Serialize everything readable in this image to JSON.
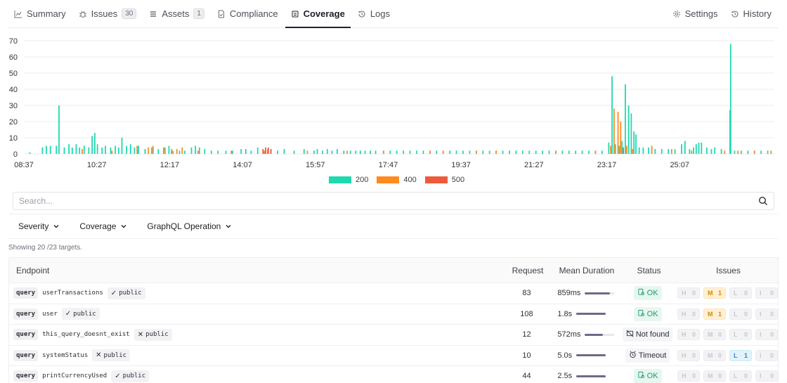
{
  "tabs": [
    {
      "label": "Summary",
      "icon": "chart-line-icon",
      "active": false
    },
    {
      "label": "Issues",
      "icon": "bug-icon",
      "count": "30",
      "active": false
    },
    {
      "label": "Assets",
      "icon": "list-icon",
      "count": "1",
      "active": false
    },
    {
      "label": "Compliance",
      "icon": "document-check-icon",
      "active": false
    },
    {
      "label": "Coverage",
      "icon": "coverage-icon",
      "active": true
    },
    {
      "label": "Logs",
      "icon": "history-icon",
      "active": false
    }
  ],
  "tabs_right": [
    {
      "label": "Settings",
      "icon": "gear-icon"
    },
    {
      "label": "History",
      "icon": "history-icon"
    }
  ],
  "colors": {
    "c200": "#1fd8b0",
    "c400": "#ff8a1f",
    "c500": "#ee5a3c",
    "accent": "#1b1f3b"
  },
  "chart_data": {
    "type": "bar",
    "y_ticks": [
      "0",
      "10",
      "20",
      "30",
      "40",
      "50",
      "60",
      "70"
    ],
    "ylim": [
      0,
      70
    ],
    "x_ticks": [
      "08:37",
      "10:27",
      "12:17",
      "14:07",
      "15:57",
      "17:47",
      "19:37",
      "21:27",
      "23:17",
      "25:07"
    ],
    "x_range_minutes": [
      517,
      1650
    ],
    "grid": true,
    "legend_position": "bottom-center",
    "series": [
      {
        "name": "200",
        "color": "#1fd8b0",
        "points": [
          [
            526,
            1
          ],
          [
            545,
            4
          ],
          [
            551,
            5
          ],
          [
            557,
            5
          ],
          [
            566,
            5
          ],
          [
            570,
            30
          ],
          [
            578,
            4
          ],
          [
            585,
            6
          ],
          [
            590,
            4
          ],
          [
            596,
            6
          ],
          [
            601,
            4
          ],
          [
            608,
            5
          ],
          [
            615,
            4
          ],
          [
            620,
            11
          ],
          [
            624,
            13
          ],
          [
            628,
            6
          ],
          [
            635,
            4
          ],
          [
            640,
            5
          ],
          [
            648,
            4
          ],
          [
            655,
            5
          ],
          [
            660,
            4
          ],
          [
            665,
            10
          ],
          [
            672,
            5
          ],
          [
            678,
            6
          ],
          [
            684,
            4
          ],
          [
            690,
            5
          ],
          [
            700,
            3
          ],
          [
            710,
            4
          ],
          [
            720,
            3
          ],
          [
            728,
            4
          ],
          [
            736,
            5
          ],
          [
            740,
            3
          ],
          [
            752,
            2
          ],
          [
            760,
            2
          ],
          [
            770,
            4
          ],
          [
            776,
            5
          ],
          [
            782,
            4
          ],
          [
            790,
            3
          ],
          [
            800,
            2
          ],
          [
            810,
            2
          ],
          [
            822,
            2
          ],
          [
            832,
            2
          ],
          [
            845,
            3
          ],
          [
            852,
            3
          ],
          [
            860,
            2
          ],
          [
            870,
            4
          ],
          [
            880,
            2
          ],
          [
            890,
            3
          ],
          [
            900,
            2
          ],
          [
            910,
            3
          ],
          [
            925,
            2
          ],
          [
            940,
            3
          ],
          [
            955,
            2
          ],
          [
            960,
            3
          ],
          [
            968,
            2
          ],
          [
            975,
            3
          ],
          [
            982,
            2
          ],
          [
            990,
            3
          ],
          [
            1000,
            2
          ],
          [
            1010,
            2
          ],
          [
            1018,
            2
          ],
          [
            1025,
            2
          ],
          [
            1032,
            2
          ],
          [
            1040,
            2
          ],
          [
            1048,
            2
          ],
          [
            1060,
            2
          ],
          [
            1070,
            2
          ],
          [
            1080,
            2
          ],
          [
            1090,
            2
          ],
          [
            1100,
            2
          ],
          [
            1110,
            2
          ],
          [
            1120,
            2
          ],
          [
            1130,
            2
          ],
          [
            1140,
            2
          ],
          [
            1150,
            2
          ],
          [
            1160,
            2
          ],
          [
            1170,
            2
          ],
          [
            1180,
            2
          ],
          [
            1190,
            2
          ],
          [
            1200,
            2
          ],
          [
            1210,
            2
          ],
          [
            1220,
            2
          ],
          [
            1230,
            2
          ],
          [
            1240,
            2
          ],
          [
            1250,
            2
          ],
          [
            1260,
            2
          ],
          [
            1270,
            2
          ],
          [
            1280,
            2
          ],
          [
            1290,
            2
          ],
          [
            1300,
            2
          ],
          [
            1310,
            2
          ],
          [
            1320,
            2
          ],
          [
            1330,
            2
          ],
          [
            1340,
            2
          ],
          [
            1350,
            2
          ],
          [
            1360,
            2
          ],
          [
            1370,
            2
          ],
          [
            1380,
            2
          ],
          [
            1390,
            2
          ],
          [
            1400,
            7
          ],
          [
            1405,
            48
          ],
          [
            1410,
            6
          ],
          [
            1416,
            5
          ],
          [
            1420,
            8
          ],
          [
            1425,
            43
          ],
          [
            1430,
            30
          ],
          [
            1434,
            25
          ],
          [
            1438,
            14
          ],
          [
            1441,
            12
          ],
          [
            1446,
            4
          ],
          [
            1452,
            4
          ],
          [
            1460,
            4
          ],
          [
            1470,
            3
          ],
          [
            1480,
            3
          ],
          [
            1490,
            3
          ],
          [
            1500,
            3
          ],
          [
            1510,
            6
          ],
          [
            1515,
            8
          ],
          [
            1522,
            3
          ],
          [
            1528,
            4
          ],
          [
            1532,
            6
          ],
          [
            1536,
            7
          ],
          [
            1540,
            7
          ],
          [
            1548,
            4
          ],
          [
            1555,
            3
          ],
          [
            1560,
            4
          ],
          [
            1570,
            3
          ],
          [
            1583,
            27
          ],
          [
            1584,
            68
          ],
          [
            1590,
            2
          ],
          [
            1600,
            2
          ],
          [
            1610,
            2
          ],
          [
            1620,
            2
          ],
          [
            1630,
            2
          ],
          [
            1640,
            2
          ]
        ]
      },
      {
        "name": "400",
        "color": "#ff8a1f",
        "points": [
          [
            605,
            3
          ],
          [
            650,
            2
          ],
          [
            688,
            5
          ],
          [
            705,
            4
          ],
          [
            712,
            5
          ],
          [
            730,
            4
          ],
          [
            742,
            2
          ],
          [
            748,
            3
          ],
          [
            756,
            4
          ],
          [
            780,
            2
          ],
          [
            830,
            2
          ],
          [
            880,
            2
          ],
          [
            885,
            3
          ],
          [
            945,
            2
          ],
          [
            1005,
            2
          ],
          [
            1060,
            2
          ],
          [
            1130,
            2
          ],
          [
            1150,
            2
          ],
          [
            1200,
            2
          ],
          [
            1230,
            2
          ],
          [
            1320,
            2
          ],
          [
            1380,
            2
          ],
          [
            1403,
            5
          ],
          [
            1408,
            28
          ],
          [
            1414,
            26
          ],
          [
            1418,
            20
          ],
          [
            1427,
            5
          ],
          [
            1436,
            3
          ],
          [
            1465,
            5
          ],
          [
            1495,
            3
          ],
          [
            1525,
            2
          ],
          [
            1575,
            2
          ],
          [
            1595,
            2
          ],
          [
            1620,
            2
          ],
          [
            1645,
            2
          ]
        ]
      },
      {
        "name": "500",
        "color": "#ee5a3c",
        "points": [
          [
            1422,
            4
          ],
          [
            878,
            3
          ],
          [
            882,
            4
          ],
          [
            886,
            4
          ],
          [
            890,
            3
          ]
        ]
      }
    ]
  },
  "search": {
    "placeholder": "Search..."
  },
  "filters": [
    {
      "label": "Severity"
    },
    {
      "label": "Coverage"
    },
    {
      "label": "GraphQL Operation"
    }
  ],
  "showing_text": "Showing 20 /23 targets.",
  "table": {
    "headers": {
      "endpoint": "Endpoint",
      "request": "Request",
      "mean_duration": "Mean Duration",
      "status": "Status",
      "issues": "Issues"
    },
    "rows": [
      {
        "kind": "query",
        "name": "userTransactions",
        "public": true,
        "public_label": "public",
        "request": "83",
        "duration": "859ms",
        "duration_level": 0.85,
        "status": "OK",
        "status_type": "ok",
        "issues": {
          "H": "0",
          "M": "1",
          "L": "0",
          "I": "0"
        }
      },
      {
        "kind": "query",
        "name": "user",
        "public": true,
        "public_label": "public",
        "request": "108",
        "duration": "1.8s",
        "duration_level": 1.0,
        "status": "OK",
        "status_type": "ok",
        "issues": {
          "H": "0",
          "M": "1",
          "L": "0",
          "I": "0"
        }
      },
      {
        "kind": "query",
        "name": "this_query_doesnt_exist",
        "public": false,
        "public_label": "public",
        "request": "12",
        "duration": "572ms",
        "duration_level": 0.6,
        "status": "Not found",
        "status_type": "nf",
        "issues": {
          "H": "0",
          "M": "0",
          "L": "0",
          "I": "0"
        }
      },
      {
        "kind": "query",
        "name": "systemStatus",
        "public": false,
        "public_label": "public",
        "request": "10",
        "duration": "5.0s",
        "duration_level": 1.0,
        "status": "Timeout",
        "status_type": "to",
        "issues": {
          "H": "0",
          "M": "0",
          "L": "1",
          "I": "0"
        }
      },
      {
        "kind": "query",
        "name": "printCurrencyUsed",
        "public": true,
        "public_label": "public",
        "request": "44",
        "duration": "2.5s",
        "duration_level": 1.0,
        "status": "OK",
        "status_type": "ok",
        "issues": {
          "H": "0",
          "M": "0",
          "L": "0",
          "I": "0"
        }
      }
    ]
  }
}
